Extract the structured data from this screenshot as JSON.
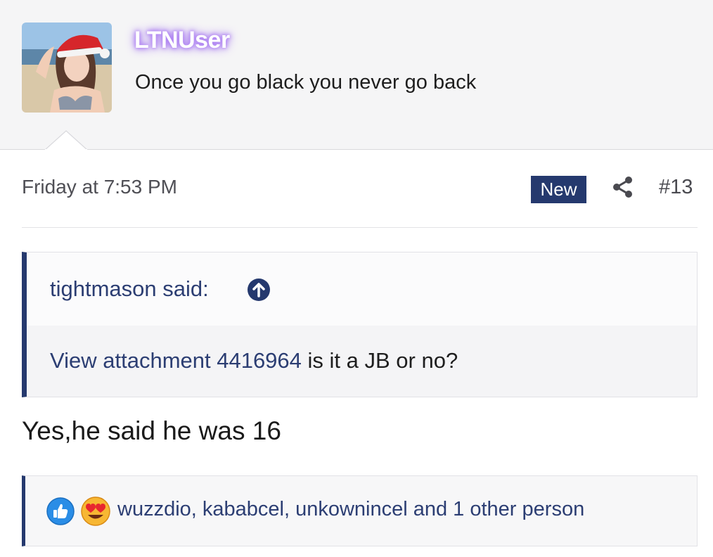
{
  "member": {
    "username": "LTNUser",
    "user_title": "Once you go black you never go back"
  },
  "post": {
    "date": "Friday at 7:53 PM",
    "badge": "New",
    "number": "#13",
    "body": "Yes,he said he was 16"
  },
  "quote": {
    "author_label": "tightmason said:",
    "link_text": "View attachment 4416964",
    "trailing_text": " is it a JB or no?"
  },
  "reactions": {
    "icons": [
      "like-icon",
      "love-eyes-icon"
    ],
    "summary": "wuzzdio, kababcel, unkownincel and 1 other person"
  },
  "colors": {
    "accent": "#25396e",
    "link": "#2c3e73",
    "username_glow": "#a06cf0"
  }
}
